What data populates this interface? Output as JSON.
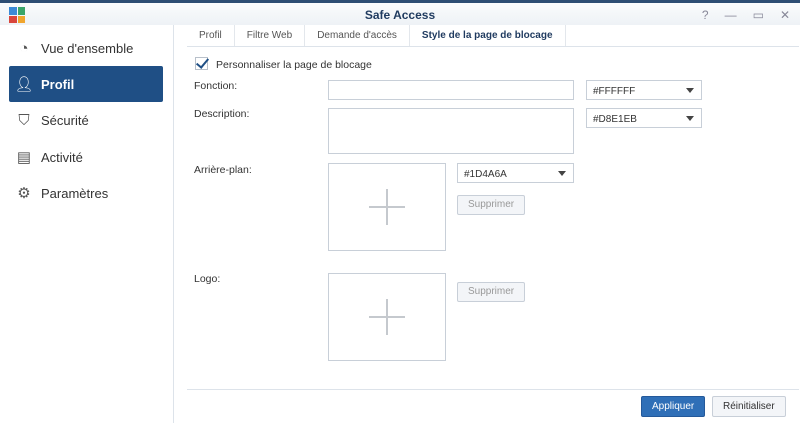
{
  "window": {
    "title": "Safe Access",
    "help": "?",
    "minimize": "—",
    "maximize": "▭",
    "close": "✕"
  },
  "sidebar": {
    "items": [
      {
        "label": "Vue d'ensemble",
        "icon": "gauge-icon"
      },
      {
        "label": "Profil",
        "icon": "user-icon"
      },
      {
        "label": "Sécurité",
        "icon": "shield-icon"
      },
      {
        "label": "Activité",
        "icon": "activity-icon"
      },
      {
        "label": "Paramètres",
        "icon": "gear-icon"
      }
    ]
  },
  "tabs": [
    "Profil",
    "Filtre Web",
    "Demande d'accès",
    "Style de la page de blocage"
  ],
  "form": {
    "customize_label": "Personnaliser la page de blocage",
    "fonction_label": "Fonction:",
    "fonction_color": "#FFFFFF",
    "description_label": "Description:",
    "description_color": "#D8E1EB",
    "background_label": "Arrière-plan:",
    "background_color": "#1D4A6A",
    "logo_label": "Logo:",
    "delete_label": "Supprimer"
  },
  "footer": {
    "apply": "Appliquer",
    "reset": "Réinitialiser"
  },
  "colors": {
    "accent": "#1f4f85",
    "apply_button": "#2f6fb7"
  }
}
